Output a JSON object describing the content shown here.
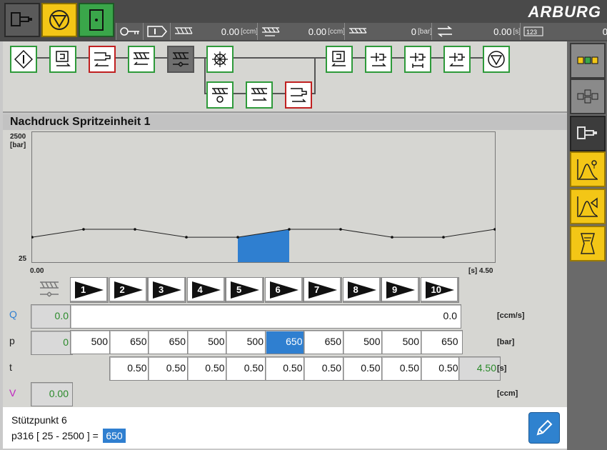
{
  "brand": "ARBURG",
  "colors": {
    "accent_blue": "#2f7fd0",
    "green_value": "#2a8a2a",
    "yellow_button": "#f3c616",
    "block_green": "#2e9a3a",
    "block_red": "#c02020"
  },
  "topbar": {
    "buttons": [
      {
        "name": "machine-mode-icon",
        "color": "#5a5a5a"
      },
      {
        "name": "stop-triangle-icon",
        "color": "#f3c616"
      },
      {
        "name": "door-icon",
        "color": "#3aa64a"
      }
    ],
    "status": [
      {
        "icon": "key-icon",
        "value": "",
        "unit": ""
      },
      {
        "icon": "input-icon",
        "value": "",
        "unit": ""
      },
      {
        "icon": "screw-metering-icon",
        "value": "0.00",
        "unit": "[ccm]"
      },
      {
        "icon": "screw-return-icon",
        "value": "0.00",
        "unit": "[ccm]"
      },
      {
        "icon": "screw-pressure-icon",
        "value": "0",
        "unit": "[bar]"
      },
      {
        "icon": "cycle-icon",
        "value": "0.00",
        "unit": "[s]"
      },
      {
        "icon": "counter-icon",
        "value": "0",
        "unit": ""
      }
    ]
  },
  "page": {
    "title": "Nachdruck Spritzeinheit 1"
  },
  "chart_data": {
    "type": "line",
    "y_axis": {
      "top": "2500",
      "top_unit": "[bar]",
      "bottom": "25"
    },
    "x_axis": {
      "left": "0.00",
      "right": "[s] 4.50"
    },
    "ylim": [
      25,
      2500
    ],
    "xlim": [
      0,
      4.5
    ],
    "x": [
      0,
      0.5,
      1.0,
      1.5,
      2.0,
      2.5,
      3.0,
      3.5,
      4.0,
      4.5
    ],
    "values": [
      500,
      650,
      650,
      500,
      500,
      650,
      650,
      500,
      500,
      650
    ],
    "highlighted_segment": {
      "index": 5,
      "color": "#2f7fd0"
    }
  },
  "profile": {
    "steps": [
      "1",
      "2",
      "3",
      "4",
      "5",
      "6",
      "7",
      "8",
      "9",
      "10"
    ],
    "rows": {
      "Q": {
        "label": "Q",
        "label_color": "#2f7fd0",
        "current": "0.0",
        "value": "0.0",
        "unit": "[ccm/s]"
      },
      "p": {
        "label": "p",
        "label_color": "#222222",
        "current": "0",
        "values": [
          "500",
          "650",
          "650",
          "500",
          "500",
          "650",
          "650",
          "500",
          "500",
          "650"
        ],
        "selected_index": 5,
        "unit": "[bar]"
      },
      "t": {
        "label": "t",
        "label_color": "#222222",
        "values": [
          "0.50",
          "0.50",
          "0.50",
          "0.50",
          "0.50",
          "0.50",
          "0.50",
          "0.50",
          "0.50"
        ],
        "total": "4.50",
        "unit": "[s]"
      },
      "V": {
        "label": "V",
        "label_color": "#c020c0",
        "current": "0.00",
        "unit": "[ccm]"
      }
    }
  },
  "info": {
    "title": "Stützpunkt 6",
    "param": "p316  [ 25 - 2500 ] =",
    "value": "650"
  },
  "sidepanel": [
    {
      "name": "overview-icon"
    },
    {
      "name": "structure-icon"
    },
    {
      "name": "injection-unit-icon"
    },
    {
      "name": "curve-icon"
    },
    {
      "name": "curve-envelope-icon"
    },
    {
      "name": "document-icon"
    }
  ]
}
